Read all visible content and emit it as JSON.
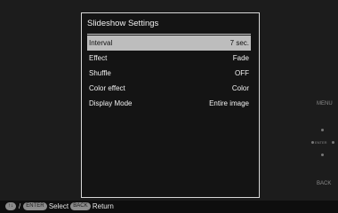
{
  "dialog": {
    "title": "Slideshow Settings",
    "rows": [
      {
        "label": "Interval",
        "value": "7 sec.",
        "selected": true
      },
      {
        "label": "Effect",
        "value": "Fade",
        "selected": false
      },
      {
        "label": "Shuffle",
        "value": "OFF",
        "selected": false
      },
      {
        "label": "Color effect",
        "value": "Color",
        "selected": false
      },
      {
        "label": "Display Mode",
        "value": "Entire image",
        "selected": false
      }
    ]
  },
  "side": {
    "menu_label": "MENU",
    "enter_label": "ENTER",
    "back_label": "BACK"
  },
  "footer": {
    "arrows_label": "↑↓",
    "slash": "/",
    "enter_key": "ENTER",
    "select_label": "Select",
    "back_key": "BACK",
    "return_label": "Return"
  },
  "colors": {
    "highlight": "#bdbdbd",
    "background": "#1c1c1c"
  }
}
